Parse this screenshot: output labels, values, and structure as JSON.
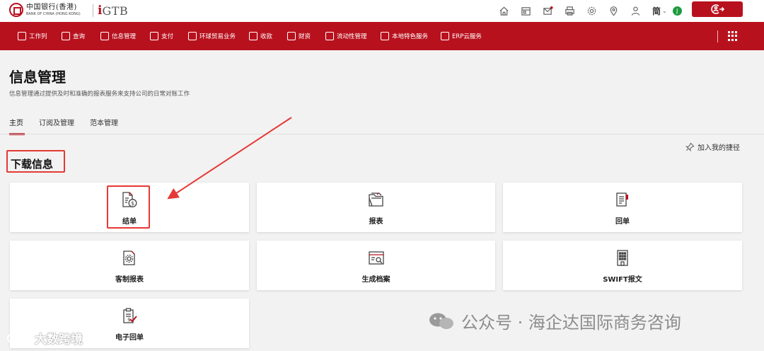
{
  "header": {
    "bank_name_cn": "中国银行(香港)",
    "bank_name_en": "BANK OF CHINA (HONG KONG)",
    "product_i": "i",
    "product_name": "GTB",
    "icons": [
      "home-icon",
      "calendar-icon",
      "mail-icon",
      "printer-icon",
      "settings-icon",
      "location-icon",
      "user-icon"
    ],
    "language": "简",
    "status_initial": "J",
    "logout_icon": "logout-icon"
  },
  "nav": {
    "items": [
      {
        "label": "工作列",
        "icon": "briefcase-icon"
      },
      {
        "label": "查询",
        "icon": "search-icon"
      },
      {
        "label": "信息管理",
        "icon": "folder-icon"
      },
      {
        "label": "支付",
        "icon": "payment-icon"
      },
      {
        "label": "环球贸易业务",
        "icon": "globe-trade-icon"
      },
      {
        "label": "收款",
        "icon": "receive-icon"
      },
      {
        "label": "财资",
        "icon": "treasury-icon"
      },
      {
        "label": "流动性管理",
        "icon": "liquidity-icon"
      },
      {
        "label": "本地特色服务",
        "icon": "bank-building-icon"
      },
      {
        "label": "ERP云服务",
        "icon": "erp-icon"
      }
    ]
  },
  "page": {
    "title": "信息管理",
    "description": "信息管理通过提供及时和准确的报表服务来支持公司的日常对账工作",
    "tabs": [
      {
        "label": "主页",
        "active": true
      },
      {
        "label": "订阅及管理",
        "active": false
      },
      {
        "label": "范本管理",
        "active": false
      }
    ],
    "shortcut_label": "加入我的捷径"
  },
  "section": {
    "title": "下载信息",
    "cards": [
      {
        "label": "结单",
        "icon": "statement-dollar-icon"
      },
      {
        "label": "报表",
        "icon": "folder-report-icon"
      },
      {
        "label": "回单",
        "icon": "receipt-icon"
      },
      {
        "label": "客制报表",
        "icon": "custom-report-gear-icon"
      },
      {
        "label": "生成档案",
        "icon": "file-search-icon"
      },
      {
        "label": "SWIFT报文",
        "icon": "swift-building-icon"
      },
      {
        "label": "电子回单",
        "icon": "e-receipt-check-icon"
      }
    ]
  },
  "watermarks": {
    "left": "大数跨境",
    "right": "公众号 · 海企达国际商务咨询"
  },
  "colors": {
    "brand_red": "#b8111e",
    "annotation_red": "#e53935",
    "status_green": "#1d9a3f"
  }
}
